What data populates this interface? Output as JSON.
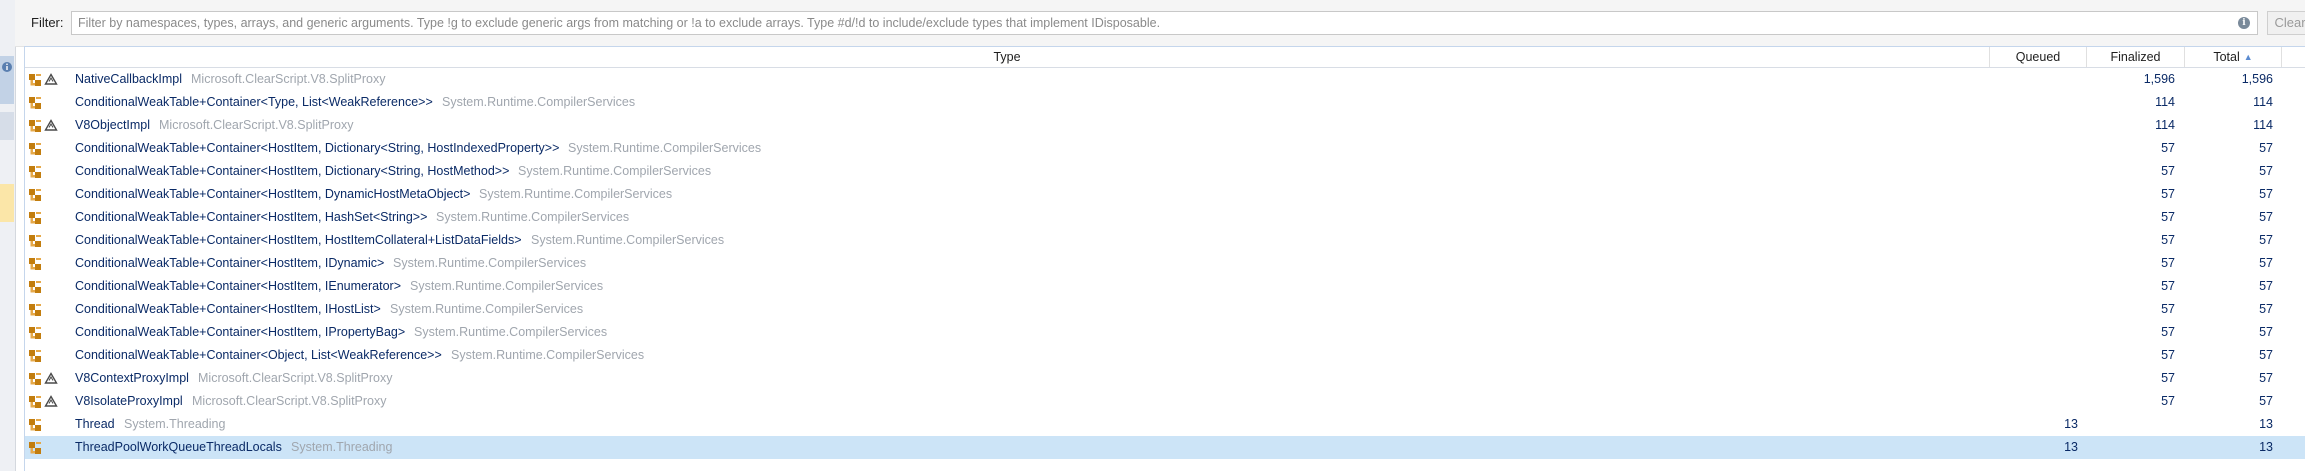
{
  "filter": {
    "label": "Filter:",
    "placeholder": "Filter by namespaces, types, arrays, and generic arguments. Type !g to exclude generic args from matching or !a to exclude arrays. Type #d/!d to include/exclude types that implement IDisposable.",
    "clear_label": "Clear",
    "info_glyph": "i"
  },
  "columns": {
    "type": "Type",
    "queued": "Queued",
    "finalized": "Finalized",
    "total": "Total",
    "sort_indicator": "▲"
  },
  "colors": {
    "selected_row": "#cce4f7",
    "type_text": "#0a2a66",
    "namespace_text": "#a0a6ae",
    "accent": "#5b8bd0"
  },
  "rows": [
    {
      "type": "NativeCallbackImpl",
      "namespace": "Microsoft.ClearScript.V8.SplitProxy",
      "queued": "",
      "finalized": "1,596",
      "total": "1,596",
      "icons": [
        "class-icon",
        "recycle-icon"
      ],
      "selected": false
    },
    {
      "type": "ConditionalWeakTable+Container<Type, List<WeakReference>>",
      "namespace": "System.Runtime.CompilerServices",
      "queued": "",
      "finalized": "114",
      "total": "114",
      "icons": [
        "class-icon"
      ],
      "selected": false
    },
    {
      "type": "V8ObjectImpl",
      "namespace": "Microsoft.ClearScript.V8.SplitProxy",
      "queued": "",
      "finalized": "114",
      "total": "114",
      "icons": [
        "class-icon",
        "recycle-icon"
      ],
      "selected": false
    },
    {
      "type": "ConditionalWeakTable+Container<HostItem, Dictionary<String, HostIndexedProperty>>",
      "namespace": "System.Runtime.CompilerServices",
      "queued": "",
      "finalized": "57",
      "total": "57",
      "icons": [
        "class-icon"
      ],
      "selected": false
    },
    {
      "type": "ConditionalWeakTable+Container<HostItem, Dictionary<String, HostMethod>>",
      "namespace": "System.Runtime.CompilerServices",
      "queued": "",
      "finalized": "57",
      "total": "57",
      "icons": [
        "class-icon"
      ],
      "selected": false
    },
    {
      "type": "ConditionalWeakTable+Container<HostItem, DynamicHostMetaObject>",
      "namespace": "System.Runtime.CompilerServices",
      "queued": "",
      "finalized": "57",
      "total": "57",
      "icons": [
        "class-icon"
      ],
      "selected": false
    },
    {
      "type": "ConditionalWeakTable+Container<HostItem, HashSet<String>>",
      "namespace": "System.Runtime.CompilerServices",
      "queued": "",
      "finalized": "57",
      "total": "57",
      "icons": [
        "class-icon"
      ],
      "selected": false
    },
    {
      "type": "ConditionalWeakTable+Container<HostItem, HostItemCollateral+ListDataFields>",
      "namespace": "System.Runtime.CompilerServices",
      "queued": "",
      "finalized": "57",
      "total": "57",
      "icons": [
        "class-icon"
      ],
      "selected": false
    },
    {
      "type": "ConditionalWeakTable+Container<HostItem, IDynamic>",
      "namespace": "System.Runtime.CompilerServices",
      "queued": "",
      "finalized": "57",
      "total": "57",
      "icons": [
        "class-icon"
      ],
      "selected": false
    },
    {
      "type": "ConditionalWeakTable+Container<HostItem, IEnumerator>",
      "namespace": "System.Runtime.CompilerServices",
      "queued": "",
      "finalized": "57",
      "total": "57",
      "icons": [
        "class-icon"
      ],
      "selected": false
    },
    {
      "type": "ConditionalWeakTable+Container<HostItem, IHostList>",
      "namespace": "System.Runtime.CompilerServices",
      "queued": "",
      "finalized": "57",
      "total": "57",
      "icons": [
        "class-icon"
      ],
      "selected": false
    },
    {
      "type": "ConditionalWeakTable+Container<HostItem, IPropertyBag>",
      "namespace": "System.Runtime.CompilerServices",
      "queued": "",
      "finalized": "57",
      "total": "57",
      "icons": [
        "class-icon"
      ],
      "selected": false
    },
    {
      "type": "ConditionalWeakTable+Container<Object, List<WeakReference>>",
      "namespace": "System.Runtime.CompilerServices",
      "queued": "",
      "finalized": "57",
      "total": "57",
      "icons": [
        "class-icon"
      ],
      "selected": false
    },
    {
      "type": "V8ContextProxyImpl",
      "namespace": "Microsoft.ClearScript.V8.SplitProxy",
      "queued": "",
      "finalized": "57",
      "total": "57",
      "icons": [
        "class-icon",
        "recycle-icon"
      ],
      "selected": false
    },
    {
      "type": "V8IsolateProxyImpl",
      "namespace": "Microsoft.ClearScript.V8.SplitProxy",
      "queued": "",
      "finalized": "57",
      "total": "57",
      "icons": [
        "class-icon",
        "recycle-icon"
      ],
      "selected": false
    },
    {
      "type": "Thread",
      "namespace": "System.Threading",
      "queued": "13",
      "finalized": "",
      "total": "13",
      "icons": [
        "class-icon"
      ],
      "selected": false
    },
    {
      "type": "ThreadPoolWorkQueueThreadLocals",
      "namespace": "System.Threading",
      "queued": "13",
      "finalized": "",
      "total": "13",
      "icons": [
        "class-icon"
      ],
      "selected": true
    }
  ]
}
